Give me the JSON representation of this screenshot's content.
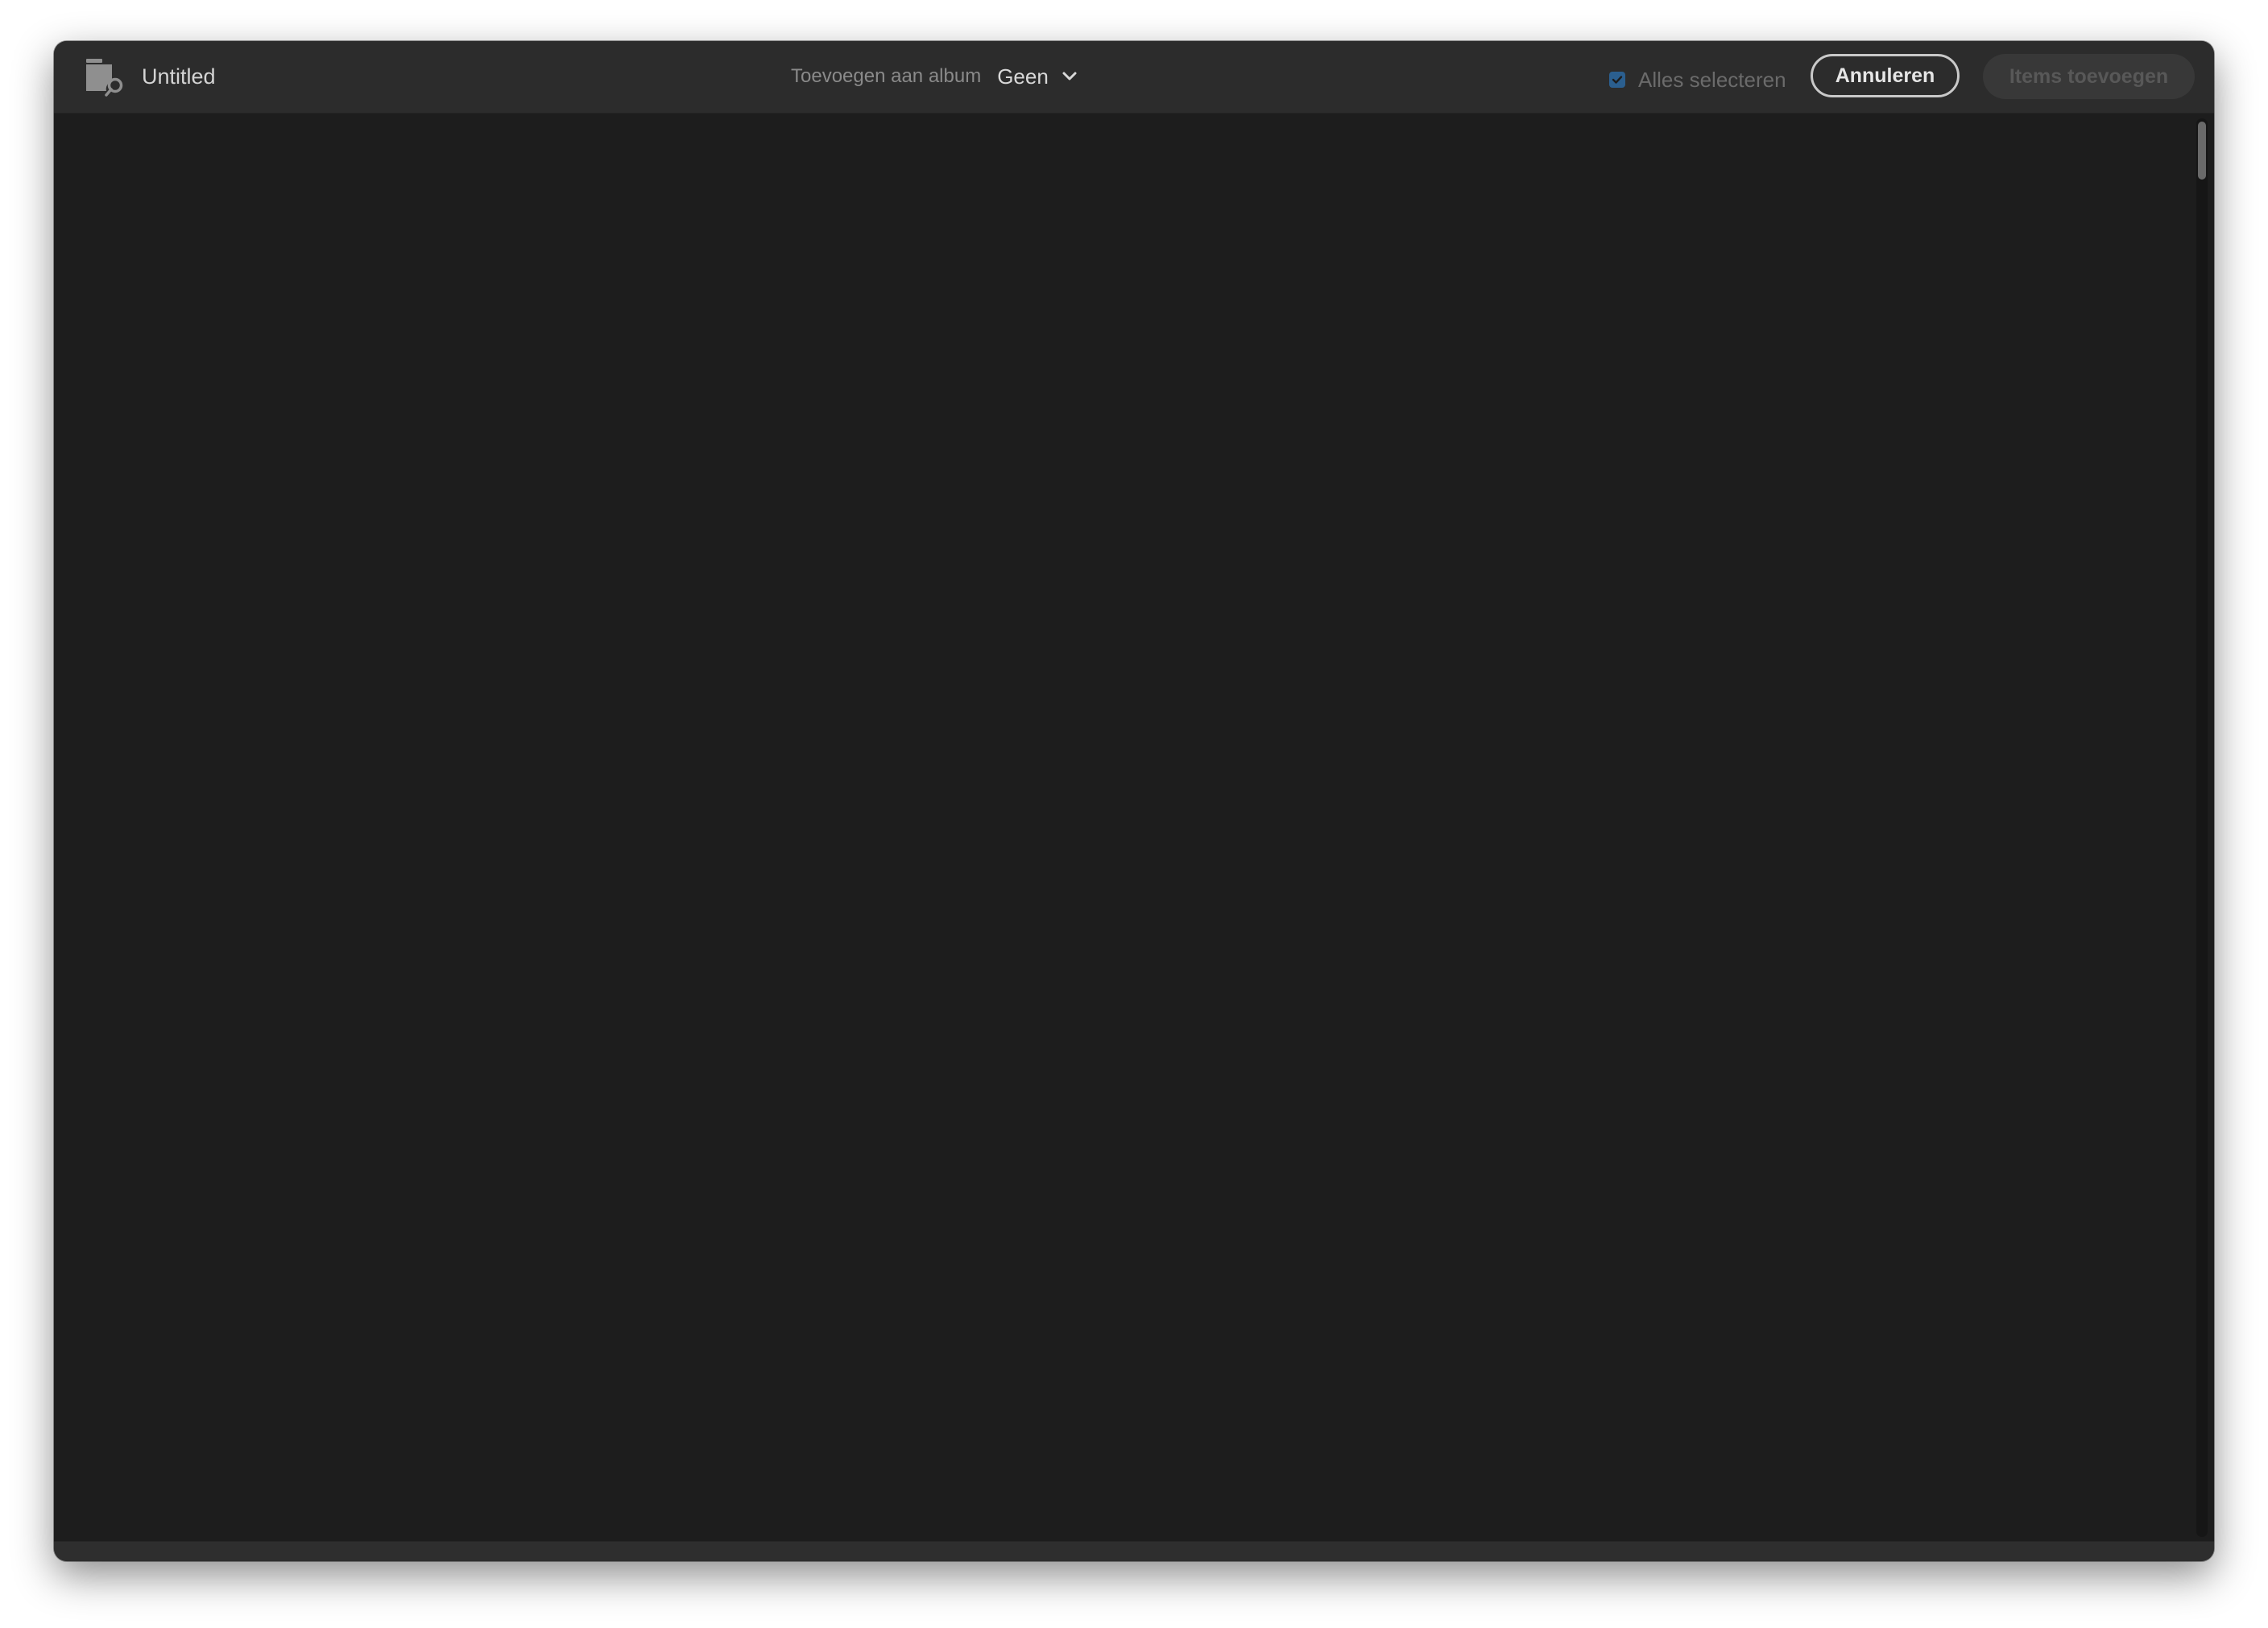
{
  "header": {
    "title": "Untitled",
    "app_icon": "folder-search-icon",
    "album_label": "Toevoegen aan album",
    "album_value": "Geen",
    "album_chevron_icon": "chevron-down-icon",
    "select_all_label": "Alles selecteren",
    "select_all_checked": true,
    "cancel_label": "Annuleren",
    "add_items_label": "Items toevoegen",
    "add_items_enabled": false
  },
  "colors": {
    "window_bg": "#1d1d1d",
    "titlebar_bg": "#2c2c2c",
    "checkbox_accent": "#2b5f8f"
  }
}
